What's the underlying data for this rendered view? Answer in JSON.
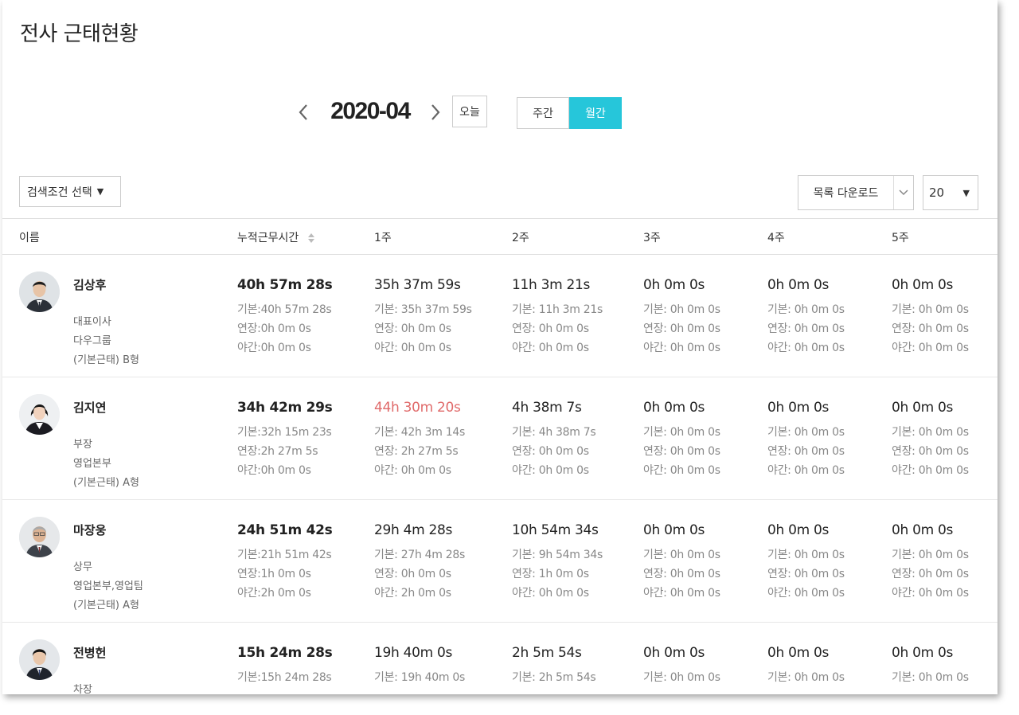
{
  "page": {
    "title": "전사 근태현황"
  },
  "period": {
    "label": "2020-04",
    "today_label": "오늘",
    "weekly_label": "주간",
    "monthly_label": "월간",
    "active_view": "monthly"
  },
  "toolbar": {
    "filter_label": "검색조건 선택",
    "download_label": "목록 다운로드",
    "page_size": "20"
  },
  "colors": {
    "accent": "#26c6da",
    "over_limit": "#e06a6a"
  },
  "table": {
    "headers": {
      "name": "이름",
      "total": "누적근무시간",
      "w1": "1주",
      "w2": "2주",
      "w3": "3주",
      "w4": "4주",
      "w5": "5주"
    },
    "rows": [
      {
        "name": "김상후",
        "position": "대표이사",
        "department": "다우그룹",
        "worktype": "(기본근태) B형",
        "total": {
          "main": "40h 57m 28s",
          "base": "기본:40h 57m 28s",
          "ext": "연장:0h 0m 0s",
          "night": "야간:0h 0m 0s"
        },
        "w1": {
          "main": "35h 37m 59s",
          "base": "기본: 35h 37m 59s",
          "ext": "연장: 0h 0m 0s",
          "night": "야간: 0h 0m 0s"
        },
        "w2": {
          "main": "11h 3m 21s",
          "base": "기본: 11h 3m 21s",
          "ext": "연장: 0h 0m 0s",
          "night": "야간: 0h 0m 0s"
        },
        "w3": {
          "main": "0h 0m 0s",
          "base": "기본: 0h 0m 0s",
          "ext": "연장: 0h 0m 0s",
          "night": "야간: 0h 0m 0s"
        },
        "w4": {
          "main": "0h 0m 0s",
          "base": "기본: 0h 0m 0s",
          "ext": "연장: 0h 0m 0s",
          "night": "야간: 0h 0m 0s"
        },
        "w5": {
          "main": "0h 0m 0s",
          "base": "기본: 0h 0m 0s",
          "ext": "연장: 0h 0m 0s",
          "night": "야간: 0h 0m 0s"
        }
      },
      {
        "name": "김지연",
        "position": "부장",
        "department": "영업본부",
        "worktype": "(기본근태) A형",
        "total": {
          "main": "34h 42m 29s",
          "base": "기본:32h 15m 23s",
          "ext": "연장:2h 27m 5s",
          "night": "야간:0h 0m 0s"
        },
        "w1": {
          "main": "44h 30m 20s",
          "base": "기본: 42h 3m 14s",
          "ext": "연장: 2h 27m 5s",
          "night": "야간: 0h 0m 0s"
        },
        "w2": {
          "main": "4h 38m 7s",
          "base": "기본: 4h 38m 7s",
          "ext": "연장: 0h 0m 0s",
          "night": "야간: 0h 0m 0s"
        },
        "w3": {
          "main": "0h 0m 0s",
          "base": "기본: 0h 0m 0s",
          "ext": "연장: 0h 0m 0s",
          "night": "야간: 0h 0m 0s"
        },
        "w4": {
          "main": "0h 0m 0s",
          "base": "기본: 0h 0m 0s",
          "ext": "연장: 0h 0m 0s",
          "night": "야간: 0h 0m 0s"
        },
        "w5": {
          "main": "0h 0m 0s",
          "base": "기본: 0h 0m 0s",
          "ext": "연장: 0h 0m 0s",
          "night": "야간: 0h 0m 0s"
        }
      },
      {
        "name": "마장웅",
        "position": "상무",
        "department": "영업본부,영업팀",
        "worktype": "(기본근태) A형",
        "total": {
          "main": "24h 51m 42s",
          "base": "기본:21h 51m 42s",
          "ext": "연장:1h 0m 0s",
          "night": "야간:2h 0m 0s"
        },
        "w1": {
          "main": "29h 4m 28s",
          "base": "기본: 27h 4m 28s",
          "ext": "연장: 0h 0m 0s",
          "night": "야간: 2h 0m 0s"
        },
        "w2": {
          "main": "10h 54m 34s",
          "base": "기본: 9h 54m 34s",
          "ext": "연장: 1h 0m 0s",
          "night": "야간: 0h 0m 0s"
        },
        "w3": {
          "main": "0h 0m 0s",
          "base": "기본: 0h 0m 0s",
          "ext": "연장: 0h 0m 0s",
          "night": "야간: 0h 0m 0s"
        },
        "w4": {
          "main": "0h 0m 0s",
          "base": "기본: 0h 0m 0s",
          "ext": "연장: 0h 0m 0s",
          "night": "야간: 0h 0m 0s"
        },
        "w5": {
          "main": "0h 0m 0s",
          "base": "기본: 0h 0m 0s",
          "ext": "연장: 0h 0m 0s",
          "night": "야간: 0h 0m 0s"
        }
      },
      {
        "name": "전병헌",
        "position": "차장",
        "department": "",
        "worktype": "",
        "total": {
          "main": "15h 24m 28s",
          "base": "기본:15h 24m 28s",
          "ext": "",
          "night": ""
        },
        "w1": {
          "main": "19h 40m 0s",
          "base": "기본: 19h 40m 0s",
          "ext": "",
          "night": ""
        },
        "w2": {
          "main": "2h 5m 54s",
          "base": "기본: 2h 5m 54s",
          "ext": "",
          "night": ""
        },
        "w3": {
          "main": "0h 0m 0s",
          "base": "기본: 0h 0m 0s",
          "ext": "",
          "night": ""
        },
        "w4": {
          "main": "0h 0m 0s",
          "base": "기본: 0h 0m 0s",
          "ext": "",
          "night": ""
        },
        "w5": {
          "main": "0h 0m 0s",
          "base": "기본: 0h 0m 0s",
          "ext": "",
          "night": ""
        }
      }
    ]
  }
}
